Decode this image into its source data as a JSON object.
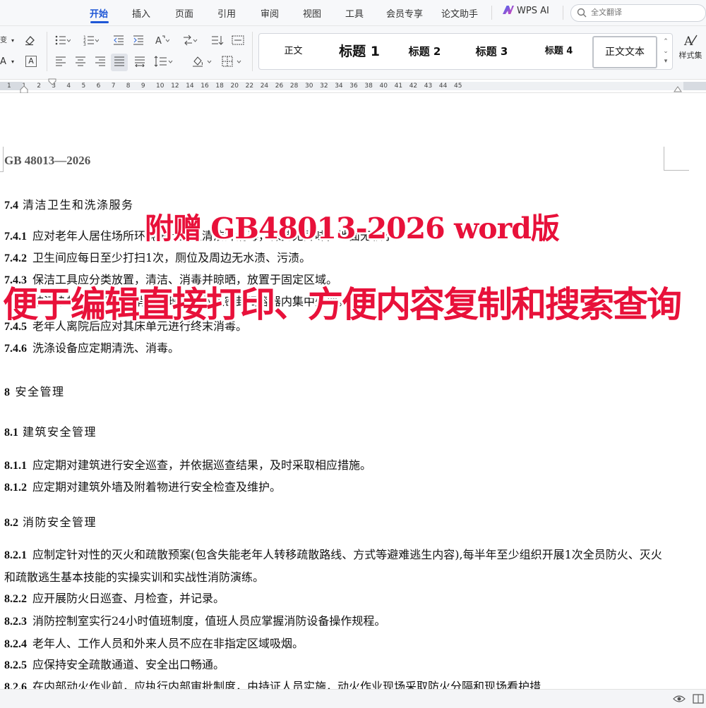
{
  "menu": {
    "tabs": [
      "开始",
      "插入",
      "页面",
      "引用",
      "审阅",
      "视图",
      "工具",
      "会员专享",
      "论文助手"
    ],
    "ai_label": "WPS AI",
    "search_placeholder": "全文翻译"
  },
  "ribbon": {
    "styles": [
      "正文",
      "标题 1",
      "标题 2",
      "标题 3",
      "标题 4",
      "正文文本"
    ],
    "current_style": "正文文本",
    "style_set_label": "样式集"
  },
  "ruler": {
    "numbers": [
      "1",
      "1",
      "2",
      "3",
      "4",
      "5",
      "6",
      "7",
      "8",
      "9",
      "10",
      "12",
      "14",
      "16",
      "18",
      "20",
      "22",
      "24",
      "26",
      "28",
      "30",
      "32",
      "34",
      "36",
      "38",
      "40",
      "41",
      "42",
      "43",
      "44",
      "45"
    ]
  },
  "document": {
    "header": "GB 48013—2026",
    "section_7_4": {
      "num": "7.4",
      "title": "清洁卫生和洗涤服务"
    },
    "items_7": [
      {
        "num": "7.4.1",
        "text": "应对老年人居住场所环境进行卫生清洁并消毒，保持无异味，地面无积水。"
      },
      {
        "num": "7.4.2",
        "text": "卫生间应每日至少打扫1次，厕位及周边无水渍、污渍。"
      },
      {
        "num": "7.4.3",
        "text": "保洁工具应分类放置，清洁、消毒并晾晒，放置于固定区域。"
      },
      {
        "num": "7.4.4",
        "text": "被污染的物品应进行消毒处理，或放入密封闭容器内集中处理。"
      },
      {
        "num": "7.4.5",
        "text": "老年人离院后应对其床单元进行终末消毒。"
      },
      {
        "num": "7.4.6",
        "text": "洗涤设备应定期清洗、消毒。"
      }
    ],
    "chapter_8": {
      "num": "8",
      "title": "安全管理"
    },
    "section_8_1": {
      "num": "8.1",
      "title": "建筑安全管理"
    },
    "items_8_1": [
      {
        "num": "8.1.1",
        "text": "应定期对建筑进行安全巡查，并依据巡查结果，及时采取相应措施。"
      },
      {
        "num": "8.1.2",
        "text": "应定期对建筑外墙及附着物进行安全检查及维护。"
      }
    ],
    "section_8_2": {
      "num": "8.2",
      "title": "消防安全管理"
    },
    "items_8_2": [
      {
        "num": "8.2.1",
        "text": "应制定针对性的灭火和疏散预案(包含失能老年人转移疏散路线、方式等避难逃生内容),每半年至少组织开展1次全员防火、灭火和疏散逃生基本技能的实操实训和实战性消防演练。"
      },
      {
        "num": "8.2.2",
        "text": "应开展防火日巡查、月检查，并记录。"
      },
      {
        "num": "8.2.3",
        "text": "消防控制室实行24小时值班制度，值班人员应掌握消防设备操作规程。"
      },
      {
        "num": "8.2.4",
        "text": "老年人、工作人员和外来人员不应在非指定区域吸烟。"
      },
      {
        "num": "8.2.5",
        "text": "应保持安全疏散通道、安全出口畅通。"
      },
      {
        "num": "8.2.6",
        "text": "在内部动火作业前，应执行内部审批制度，由持证人员实施，动火作业现场采取防火分隔和现场看护措"
      }
    ]
  },
  "promo": {
    "line1": "附赠 GB48013-2026 word版",
    "line2": "便于编辑直接打印、方便内容复制和搜索查询"
  },
  "colors": {
    "accent": "#1f57d6",
    "promo_red": "#e8113a"
  }
}
